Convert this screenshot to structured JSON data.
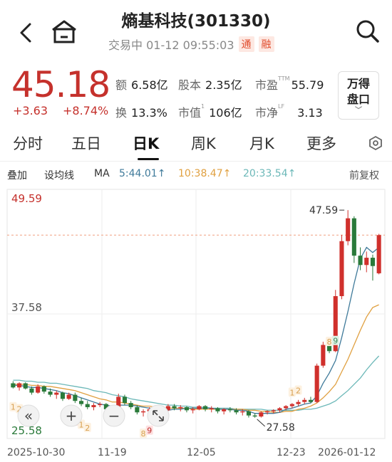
{
  "header": {
    "title": "熵基科技(301330)",
    "status": "交易中 01-12 09:55:03",
    "tag_tong": "通",
    "tag_rong": "融"
  },
  "quote": {
    "price": "45.18",
    "change": "+3.63",
    "change_pct": "+8.74%",
    "color_up": "#c5312c"
  },
  "stats": {
    "amount_label": "额",
    "amount": "6.58亿",
    "capital_label": "股本",
    "capital": "2.35亿",
    "pe_label": "市盈",
    "pe_sup": "TTM",
    "pe": "55.79",
    "turnover_label": "换",
    "turnover": "13.3%",
    "mktcap_label": "市值",
    "mktcap_sup": "1",
    "mktcap": "106亿",
    "pb_label": "市净",
    "pb_sup": "LF",
    "pb": "3.13"
  },
  "wande_button": {
    "line1": "万得",
    "line2": "盘口"
  },
  "tabs": [
    "分时",
    "五日",
    "日K",
    "周K",
    "月K",
    "更多"
  ],
  "active_tab": "日K",
  "ma_bar": {
    "overlay": "叠加",
    "set_ma": "设均线",
    "ma_label": "MA",
    "ma5": "5:44.01↑",
    "ma10": "10:38.47↑",
    "ma20": "20:33.54↑",
    "adjust": "前复权",
    "color_ma5": "#3f7a9a",
    "color_ma10": "#e0a040",
    "color_ma20": "#6cb8b8"
  },
  "chart_data": {
    "type": "candlestick",
    "y_top_label": "49.59",
    "y_mid_label": "37.58",
    "y_bottom_label": "25.58",
    "ylim": [
      25.58,
      49.59
    ],
    "x_labels": [
      "2025-10-30",
      "11-19",
      "12-05",
      "12-23",
      "2026-01-12"
    ],
    "high_annotation": "47.59",
    "low_annotation": "27.58",
    "current_price_line": 45.18,
    "candles": [
      [
        30.9,
        31.1,
        30.4,
        30.5
      ],
      [
        30.5,
        31.0,
        30.2,
        30.9
      ],
      [
        30.9,
        31.0,
        30.3,
        30.4
      ],
      [
        30.4,
        30.6,
        29.8,
        30.0
      ],
      [
        30.0,
        30.8,
        29.9,
        30.6
      ],
      [
        30.6,
        30.7,
        29.9,
        30.1
      ],
      [
        30.1,
        30.4,
        29.6,
        29.8
      ],
      [
        29.8,
        30.2,
        29.4,
        30.0
      ],
      [
        30.0,
        30.1,
        29.2,
        29.4
      ],
      [
        29.4,
        30.0,
        29.3,
        29.8
      ],
      [
        29.8,
        30.0,
        29.0,
        29.2
      ],
      [
        29.2,
        29.5,
        28.7,
        28.9
      ],
      [
        28.9,
        29.2,
        28.4,
        28.6
      ],
      [
        28.6,
        29.0,
        28.3,
        28.8
      ],
      [
        28.8,
        29.1,
        28.6,
        28.9
      ],
      [
        28.9,
        29.0,
        28.2,
        28.4
      ],
      [
        28.4,
        28.8,
        28.1,
        28.6
      ],
      [
        28.6,
        29.9,
        28.5,
        29.6
      ],
      [
        29.6,
        29.8,
        28.8,
        29.0
      ],
      [
        29.0,
        29.2,
        28.4,
        28.6
      ],
      [
        28.6,
        28.8,
        27.9,
        28.1
      ],
      [
        28.1,
        28.4,
        27.7,
        28.2
      ],
      [
        28.2,
        28.6,
        28.0,
        28.4
      ],
      [
        28.4,
        28.7,
        28.0,
        28.2
      ],
      [
        28.2,
        28.5,
        27.9,
        28.3
      ],
      [
        28.3,
        28.9,
        28.2,
        28.7
      ],
      [
        28.7,
        28.9,
        28.3,
        28.5
      ],
      [
        28.5,
        28.8,
        28.2,
        28.6
      ],
      [
        28.6,
        28.7,
        28.1,
        28.3
      ],
      [
        28.3,
        28.6,
        28.0,
        28.4
      ],
      [
        28.4,
        28.8,
        28.3,
        28.7
      ],
      [
        28.7,
        28.8,
        28.2,
        28.4
      ],
      [
        28.4,
        28.7,
        28.1,
        28.5
      ],
      [
        28.5,
        28.6,
        28.0,
        28.2
      ],
      [
        28.2,
        28.5,
        27.9,
        28.4
      ],
      [
        28.4,
        28.6,
        28.1,
        28.3
      ],
      [
        28.3,
        28.5,
        27.9,
        28.1
      ],
      [
        28.1,
        28.4,
        27.8,
        28.2
      ],
      [
        28.2,
        28.3,
        27.6,
        27.8
      ],
      [
        27.8,
        28.0,
        27.58,
        27.7
      ],
      [
        27.7,
        28.2,
        27.6,
        28.1
      ],
      [
        28.1,
        28.3,
        27.9,
        28.2
      ],
      [
        28.2,
        28.4,
        28.0,
        28.3
      ],
      [
        28.3,
        28.6,
        28.1,
        28.5
      ],
      [
        28.5,
        28.8,
        28.3,
        28.7
      ],
      [
        28.7,
        29.0,
        28.5,
        28.9
      ],
      [
        28.9,
        29.3,
        28.7,
        29.1
      ],
      [
        29.1,
        29.5,
        28.9,
        29.3
      ],
      [
        29.3,
        29.6,
        29.0,
        29.1
      ],
      [
        29.1,
        32.8,
        29.0,
        32.6
      ],
      [
        32.6,
        34.9,
        32.4,
        34.6
      ],
      [
        34.6,
        35.3,
        33.8,
        34.0
      ],
      [
        34.0,
        39.9,
        33.9,
        39.3
      ],
      [
        39.3,
        45.2,
        39.0,
        44.6
      ],
      [
        44.6,
        47.59,
        44.2,
        46.8
      ],
      [
        46.8,
        47.0,
        42.5,
        43.2
      ],
      [
        43.2,
        44.0,
        41.8,
        42.3
      ],
      [
        42.3,
        43.6,
        41.6,
        43.0
      ],
      [
        43.0,
        43.3,
        40.8,
        42.2
      ],
      [
        41.5,
        45.3,
        41.4,
        45.18
      ]
    ],
    "ma5": [
      30.7,
      30.7,
      30.6,
      30.5,
      30.5,
      30.4,
      30.3,
      30.2,
      30.0,
      29.9,
      29.7,
      29.5,
      29.3,
      29.1,
      28.9,
      28.8,
      28.7,
      28.8,
      28.8,
      28.8,
      28.7,
      28.6,
      28.5,
      28.5,
      28.3,
      28.3,
      28.4,
      28.4,
      28.5,
      28.5,
      28.5,
      28.5,
      28.5,
      28.4,
      28.4,
      28.4,
      28.3,
      28.3,
      28.2,
      28.0,
      28.0,
      28.0,
      28.0,
      28.1,
      28.4,
      28.5,
      28.7,
      28.9,
      29.0,
      29.7,
      30.9,
      31.9,
      33.1,
      35.3,
      37.8,
      40.5,
      42.9,
      44.0,
      43.5,
      44.0
    ],
    "ma10": [
      30.8,
      30.8,
      30.8,
      30.7,
      30.7,
      30.6,
      30.6,
      30.5,
      30.4,
      30.3,
      30.2,
      30.0,
      29.8,
      29.6,
      29.4,
      29.3,
      29.1,
      29.1,
      29.0,
      28.9,
      28.8,
      28.7,
      28.7,
      28.6,
      28.5,
      28.5,
      28.5,
      28.5,
      28.5,
      28.4,
      28.4,
      28.4,
      28.4,
      28.4,
      28.4,
      28.4,
      28.4,
      28.4,
      28.3,
      28.3,
      28.2,
      28.2,
      28.1,
      28.1,
      28.2,
      28.2,
      28.4,
      28.5,
      28.7,
      29.0,
      29.5,
      30.1,
      30.8,
      32.0,
      33.2,
      34.6,
      36.0,
      37.3,
      38.2,
      38.47
    ],
    "ma20": [
      31.2,
      31.2,
      31.1,
      31.1,
      31.0,
      31.0,
      30.9,
      30.9,
      30.8,
      30.7,
      30.6,
      30.5,
      30.4,
      30.2,
      30.1,
      30.0,
      29.8,
      29.7,
      29.6,
      29.4,
      29.3,
      29.2,
      29.1,
      29.0,
      28.9,
      28.8,
      28.8,
      28.7,
      28.7,
      28.6,
      28.6,
      28.6,
      28.5,
      28.5,
      28.5,
      28.5,
      28.4,
      28.4,
      28.4,
      28.4,
      28.4,
      28.3,
      28.3,
      28.3,
      28.3,
      28.3,
      28.3,
      28.4,
      28.4,
      28.5,
      28.7,
      28.9,
      29.2,
      29.7,
      30.2,
      30.8,
      31.4,
      32.2,
      32.9,
      33.54
    ]
  },
  "markers": {
    "m1": "1",
    "m2": "2",
    "m8": "8",
    "m9": "9"
  },
  "controls": {
    "rewind": "«",
    "zoom_in": "+",
    "zoom_out": "−"
  }
}
